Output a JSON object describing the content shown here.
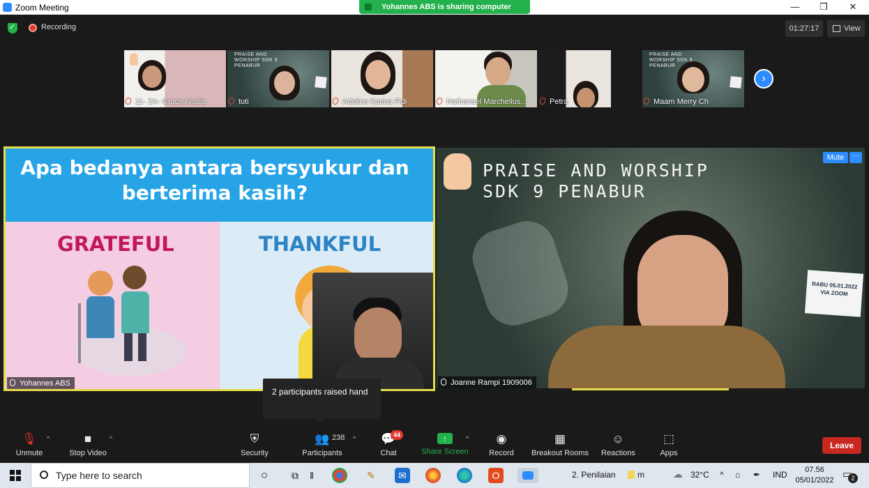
{
  "window": {
    "title": "Zoom Meeting",
    "minimize_icon": "—",
    "restore_icon": "❐",
    "close_icon": "✕"
  },
  "share_banner": "Yohannes ABS is sharing computer sound",
  "recording_label": "Recording",
  "timer": "01:27:17",
  "view_label": "View",
  "thumbnails": [
    {
      "name": "11- 2A- Grace Analia"
    },
    {
      "name": "tuti"
    },
    {
      "name": "Adeline Karina Fidi"
    },
    {
      "name": "Nathanael Marchellus..."
    },
    {
      "name": "Petra"
    },
    {
      "name": "Maam Merry Ch"
    }
  ],
  "thumb_slide_text": "PRAISE AND WORSHIP SDK 9 PENABUR",
  "slide": {
    "question": "Apa bedanya antara bersyukur dan berterima kasih?",
    "left_label": "GRATEFUL",
    "right_label": "THANKFUL"
  },
  "tile_left_name": "Yohannes ABS",
  "tile_right": {
    "title_line1": "PRAISE AND WORSHIP",
    "title_line2": "SDK 9 PENABUR",
    "name": "Joanne Rampi 1909006",
    "mute_label": "Mute",
    "more_label": "···",
    "sign_text": "RABU 05.01.2022 VIA ZOOM"
  },
  "tooltip": "2 participants raised hand",
  "toolbar": {
    "unmute": "Unmute",
    "stop_video": "Stop Video",
    "security": "Security",
    "participants": "Participants",
    "participants_count": "238",
    "chat": "Chat",
    "chat_badge": "44",
    "share_screen": "Share Screen",
    "record": "Record",
    "breakout_rooms": "Breakout Rooms",
    "reactions": "Reactions",
    "apps": "Apps",
    "leave": "Leave"
  },
  "taskbar": {
    "search_placeholder": "Type here to search",
    "task_label": "2. Penilaian",
    "task_label2": "m",
    "temperature": "32°C",
    "language": "IND",
    "time": "07.56",
    "date": "05/01/2022",
    "notification_count": "2"
  },
  "colors": {
    "accent_blue": "#2d8cff",
    "share_green": "#22b14c",
    "leave_red": "#c8281f",
    "active_speaker_border": "#e6dd4a"
  }
}
